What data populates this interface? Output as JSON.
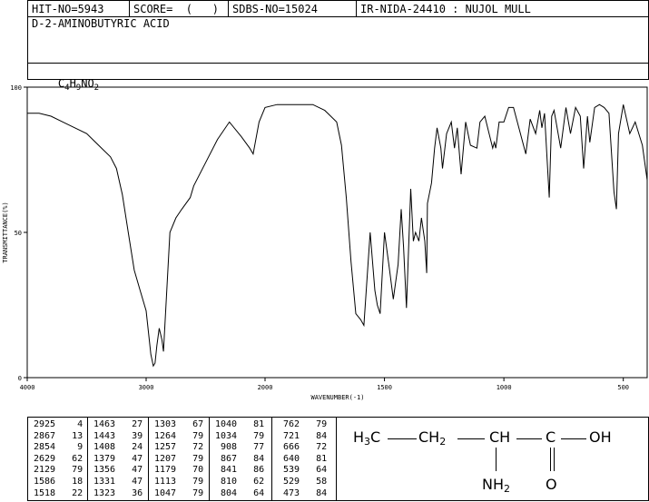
{
  "header": {
    "hit_no": "HIT-NO=5943",
    "score": "SCORE=  (   )",
    "sdbs_no": "SDBS-NO=15024",
    "ir_info": "IR-NIDA-24410 : NUJOL MULL"
  },
  "compound": {
    "name": "D-2-AMINOBUTYRIC ACID",
    "formula_parts": [
      "C",
      "4",
      "H",
      "9",
      "NO",
      "2"
    ]
  },
  "chart_data": {
    "type": "line",
    "xlabel": "WAVENUMBER(-1)",
    "ylabel": "TRANSMITTANCE(%)",
    "xlim": [
      4000,
      400
    ],
    "ylim": [
      0,
      100
    ],
    "x_ticks": [
      "4000",
      "3000",
      "2000",
      "1500",
      "1000",
      "500"
    ],
    "y_ticks": [
      "0",
      "50",
      "100"
    ],
    "series": [
      {
        "x": [
          4000,
          3900,
          3800,
          3700,
          3600,
          3500,
          3400,
          3300,
          3250,
          3200,
          3150,
          3100,
          3050,
          3000,
          2960,
          2940,
          2925,
          2910,
          2890,
          2867,
          2854,
          2800,
          2750,
          2700,
          2629,
          2600,
          2500,
          2400,
          2300,
          2200,
          2129,
          2100,
          2050,
          2000,
          1950,
          1900,
          1850,
          1800,
          1750,
          1700,
          1680,
          1660,
          1640,
          1620,
          1600,
          1586,
          1560,
          1540,
          1530,
          1518,
          1500,
          1480,
          1463,
          1443,
          1430,
          1420,
          1408,
          1390,
          1379,
          1370,
          1356,
          1345,
          1331,
          1323,
          1320,
          1303,
          1290,
          1280,
          1264,
          1257,
          1240,
          1220,
          1207,
          1195,
          1179,
          1160,
          1140,
          1113,
          1100,
          1080,
          1047,
          1040,
          1034,
          1020,
          1000,
          980,
          960,
          908,
          890,
          867,
          850,
          841,
          830,
          810,
          800,
          790,
          762,
          740,
          721,
          700,
          680,
          666,
          650,
          640,
          620,
          600,
          580,
          560,
          539,
          529,
          520,
          500,
          473,
          450,
          420,
          400
        ],
        "y": [
          91,
          91,
          90,
          88,
          86,
          84,
          80,
          76,
          72,
          63,
          50,
          37,
          30,
          23,
          8,
          4,
          5,
          11,
          17,
          13,
          9,
          50,
          55,
          58,
          62,
          66,
          74,
          82,
          88,
          83,
          79,
          77,
          88,
          93,
          94,
          94,
          94,
          94,
          92,
          88,
          80,
          62,
          40,
          22,
          20,
          18,
          50,
          30,
          25,
          22,
          50,
          38,
          27,
          39,
          58,
          45,
          24,
          65,
          47,
          50,
          47,
          55,
          47,
          36,
          60,
          67,
          79,
          86,
          79,
          72,
          84,
          88,
          79,
          86,
          70,
          88,
          80,
          79,
          88,
          90,
          79,
          81,
          79,
          88,
          88,
          93,
          93,
          77,
          89,
          84,
          92,
          86,
          91,
          62,
          90,
          92,
          79,
          93,
          84,
          93,
          90,
          72,
          90,
          81,
          93,
          94,
          93,
          91,
          64,
          58,
          84,
          94,
          84,
          88,
          80,
          68
        ]
      }
    ]
  },
  "peaks": [
    [
      [
        "2925",
        "4"
      ],
      [
        "2867",
        "13"
      ],
      [
        "2854",
        "9"
      ],
      [
        "2629",
        "62"
      ],
      [
        "2129",
        "79"
      ],
      [
        "1586",
        "18"
      ],
      [
        "1518",
        "22"
      ]
    ],
    [
      [
        "1463",
        "27"
      ],
      [
        "1443",
        "39"
      ],
      [
        "1408",
        "24"
      ],
      [
        "1379",
        "47"
      ],
      [
        "1356",
        "47"
      ],
      [
        "1331",
        "47"
      ],
      [
        "1323",
        "36"
      ]
    ],
    [
      [
        "1303",
        "67"
      ],
      [
        "1264",
        "79"
      ],
      [
        "1257",
        "72"
      ],
      [
        "1207",
        "79"
      ],
      [
        "1179",
        "70"
      ],
      [
        "1113",
        "79"
      ],
      [
        "1047",
        "79"
      ]
    ],
    [
      [
        "1040",
        "81"
      ],
      [
        "1034",
        "79"
      ],
      [
        "908",
        "77"
      ],
      [
        "867",
        "84"
      ],
      [
        "841",
        "86"
      ],
      [
        "810",
        "62"
      ],
      [
        "804",
        "64"
      ]
    ],
    [
      [
        "762",
        "79"
      ],
      [
        "721",
        "84"
      ],
      [
        "666",
        "72"
      ],
      [
        "640",
        "81"
      ],
      [
        "539",
        "64"
      ],
      [
        "529",
        "58"
      ],
      [
        "473",
        "84"
      ]
    ]
  ],
  "structure": {
    "ch3": "H3C",
    "ch2": "CH2",
    "ch": "CH",
    "c": "C",
    "oh": "OH",
    "nh2": "NH2",
    "o": "O"
  }
}
